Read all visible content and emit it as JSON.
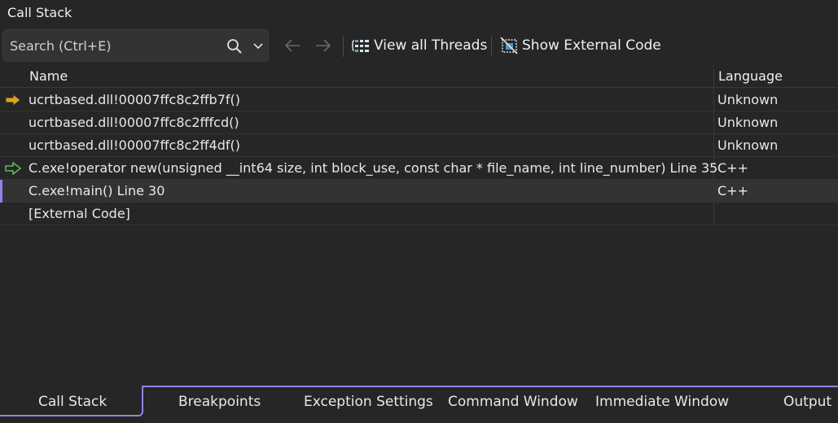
{
  "window": {
    "title": "Call Stack"
  },
  "toolbar": {
    "search_placeholder": "Search (Ctrl+E)",
    "search_icon": "search-icon",
    "back_icon": "arrow-left-icon",
    "forward_icon": "arrow-right-icon",
    "view_threads_label": "View all Threads",
    "show_external_label": "Show External Code"
  },
  "grid": {
    "columns": {
      "name": "Name",
      "language": "Language"
    },
    "rows": [
      {
        "name": "ucrtbased.dll!00007ffc8c2ffb7f()",
        "language": "Unknown",
        "marker": "current-frame-arrow"
      },
      {
        "name": "ucrtbased.dll!00007ffc8c2fffcd()",
        "language": "Unknown",
        "marker": ""
      },
      {
        "name": "ucrtbased.dll!00007ffc8c2ff4df()",
        "language": "Unknown",
        "marker": ""
      },
      {
        "name": "C.exe!operator new(unsigned __int64 size, int block_use, const char * file_name, int line_number) Line 35",
        "language": "C++",
        "marker": "return-frame-arrow"
      },
      {
        "name": "C.exe!main() Line 30",
        "language": "C++",
        "marker": "selected"
      },
      {
        "name": "[External Code]",
        "language": "",
        "marker": ""
      }
    ]
  },
  "tabs": {
    "call_stack": "Call Stack",
    "breakpoints": "Breakpoints",
    "exception_settings": "Exception Settings",
    "command_window": "Command Window",
    "immediate_window": "Immediate Window",
    "output": "Output"
  },
  "colors": {
    "background": "#262626",
    "accent": "#9a7ee8",
    "current_arrow": "#d9a520",
    "return_arrow": "#5cb85c"
  }
}
